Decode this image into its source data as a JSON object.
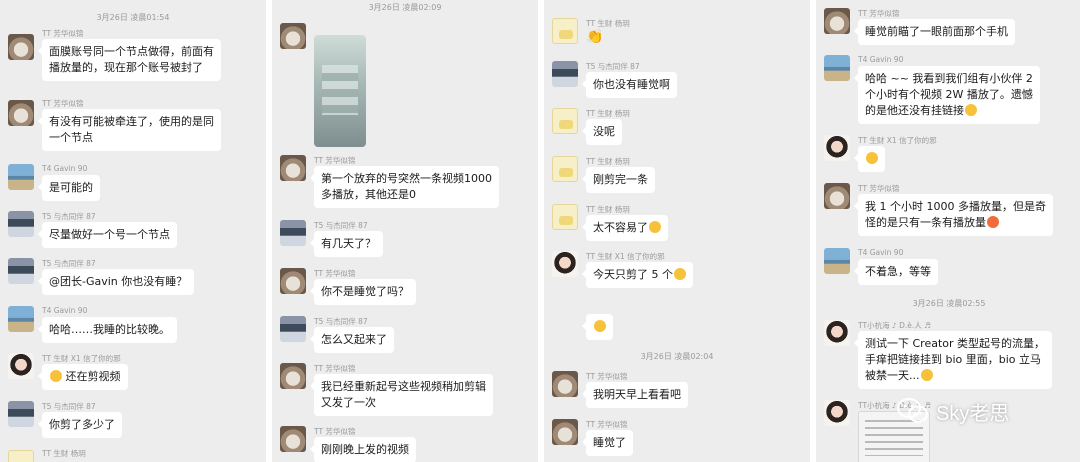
{
  "panels": [
    {
      "time": "3月26日 凌晨01:54",
      "messages": [
        {
          "sender": "TT 芳华似锦",
          "text": "面膜账号同一个节点做得，前面有\n播放量的，现在那个账号被封了"
        },
        {
          "sender": "TT 芳华似锦",
          "text": "有没有可能被牵连了，使用的是同\n一个节点"
        },
        {
          "sender": "T4 Gavin 90",
          "text": "是可能的"
        },
        {
          "sender": "T5 与杰同伴 87",
          "text": "尽量做好一个号一个节点"
        },
        {
          "sender": "T5 与杰同伴 87",
          "text": "@团长-Gavin  你也没有睡？"
        },
        {
          "sender": "T4 Gavin 90",
          "text": "哈哈……我睡的比较晚。"
        },
        {
          "sender": "TT 生财 X1 信了你的邪",
          "text": "还在剪视频"
        },
        {
          "sender": "T5 与杰同伴 87",
          "text": "你剪了多少了"
        },
        {
          "sender": "TT 生财 杨玥",
          "text": ""
        }
      ]
    },
    {
      "time": "3月26日 凌晨02:09",
      "messages": [
        {
          "sender": "TT 芳华似锦",
          "text": "第一个放弃的号突然一条视频1000\n多播放，其他还是0"
        },
        {
          "sender": "T5 与杰同伴 87",
          "text": "有几天了？"
        },
        {
          "sender": "TT 芳华似锦",
          "text": "你不是睡觉了吗？"
        },
        {
          "sender": "T5 与杰同伴 87",
          "text": "怎么又起来了"
        },
        {
          "sender": "TT 芳华似锦",
          "text": "我已经重新起号这些视频稍加剪辑\n又发了一次"
        },
        {
          "sender": "TT 芳华似锦",
          "text": "刚刚晚上发的视频"
        }
      ]
    },
    {
      "time": "3月26日 凌晨02:04",
      "messages": [
        {
          "sender": "TT 生财 杨玥",
          "text": ""
        },
        {
          "sender": "T5 与杰同伴 87",
          "text": "你也没有睡觉啊"
        },
        {
          "sender": "TT 生财 杨玥",
          "text": "没呢"
        },
        {
          "sender": "TT 生财 杨玥",
          "text": "刚剪完一条"
        },
        {
          "sender": "TT 生财 杨玥",
          "text": "太不容易了"
        },
        {
          "sender": "TT 生财 X1 信了你的邪",
          "text": "今天只剪了 5 个"
        },
        {
          "sender": "TT 芳华似锦",
          "text": "我明天早上看看吧"
        },
        {
          "sender": "TT 芳华似锦",
          "text": "睡觉了"
        }
      ]
    },
    {
      "time": "3月26日 凌晨02:55",
      "messages": [
        {
          "sender": "TT 芳华似锦",
          "text": "睡觉前瞄了一眼前面那个手机"
        },
        {
          "sender": "T4 Gavin 90",
          "text": "哈哈 ~~ 我看到我们组有小伙伴 2\n个小时有个视频 2W 播放了。遗憾\n的是他还没有挂链接"
        },
        {
          "sender": "TT 生财 X1 信了你的邪",
          "text": ""
        },
        {
          "sender": "TT 芳华似锦",
          "text": "我 1 个小时 1000 多播放量，但是奇\n怪的是只有一条有播放量"
        },
        {
          "sender": "T4 Gavin 90",
          "text": "不着急，等等"
        },
        {
          "sender": "TT小杭海 ♪ D.è.人 ♬",
          "text": "测试一下 Creator 类型起号的流量，\n手痒把链接挂到 bio 里面，bio 立马\n被禁一天..."
        },
        {
          "sender": "TT小杭海 ♪ D.è.人 ♬",
          "text": ""
        }
      ]
    }
  ],
  "watermark": "Sky老思"
}
